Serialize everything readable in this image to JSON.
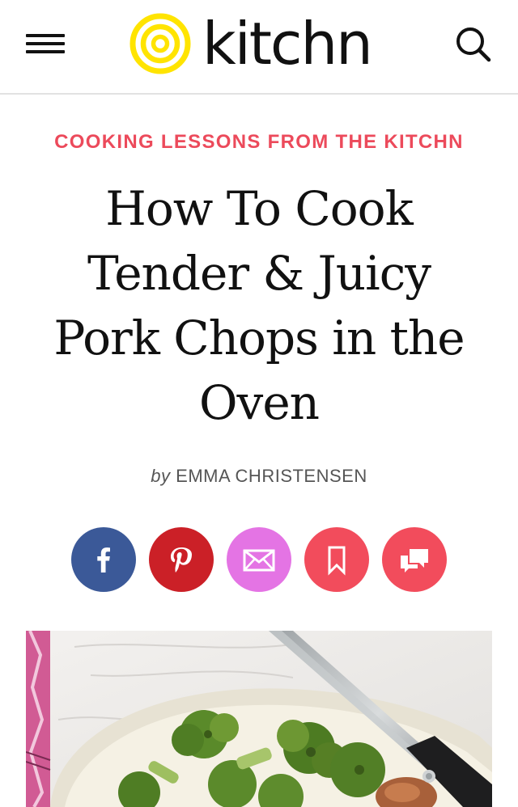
{
  "header": {
    "logo_text": "kitchn",
    "menu_icon": "hamburger-menu-icon",
    "search_icon": "search-icon",
    "logo_color": "#ffe400"
  },
  "article": {
    "kicker": "COOKING LESSONS FROM THE KITCHN",
    "title_lines": [
      "How To Cook",
      "Tender & Juicy",
      "Pork Chops in the",
      "Oven"
    ],
    "byline_prefix": "by",
    "author": "EMMA CHRISTENSEN"
  },
  "share": {
    "buttons": [
      {
        "name": "facebook",
        "icon": "facebook-icon",
        "color": "#3b5998"
      },
      {
        "name": "pinterest",
        "icon": "pinterest-icon",
        "color": "#cb2027"
      },
      {
        "name": "email",
        "icon": "email-icon",
        "color": "#e474e4"
      },
      {
        "name": "save",
        "icon": "bookmark-icon",
        "color": "#f24c5c"
      },
      {
        "name": "comments",
        "icon": "comment-icon",
        "color": "#f24c5c"
      }
    ]
  },
  "colors": {
    "accent": "#ec4a5b"
  }
}
